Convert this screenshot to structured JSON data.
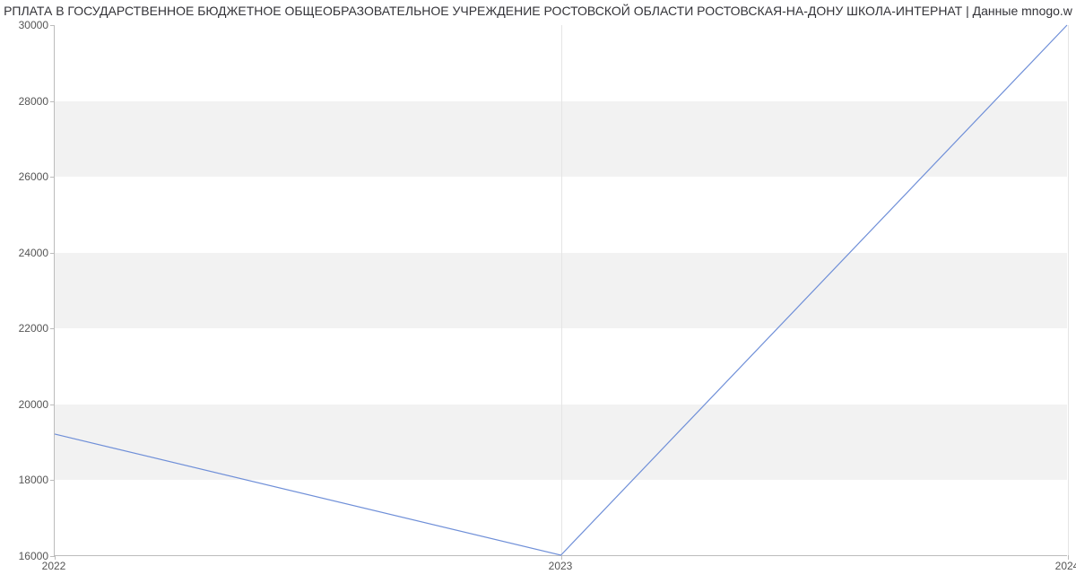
{
  "chart_data": {
    "type": "line",
    "title": "РПЛАТА В ГОСУДАРСТВЕННОЕ БЮДЖЕТНОЕ ОБЩЕОБРАЗОВАТЕЛЬНОЕ УЧРЕЖДЕНИЕ РОСТОВСКОЙ ОБЛАСТИ РОСТОВСКАЯ-НА-ДОНУ ШКОЛА-ИНТЕРНАТ | Данные mnogo.w",
    "x": [
      2022,
      2023,
      2024
    ],
    "values": [
      19200,
      16000,
      30000
    ],
    "xlabel": "",
    "ylabel": "",
    "y_ticks": [
      16000,
      18000,
      20000,
      22000,
      24000,
      26000,
      28000,
      30000
    ],
    "x_ticks": [
      2022,
      2023,
      2024
    ],
    "ylim": [
      16000,
      30000
    ],
    "xlim": [
      2022,
      2024
    ],
    "line_color": "#6f8fd8"
  }
}
